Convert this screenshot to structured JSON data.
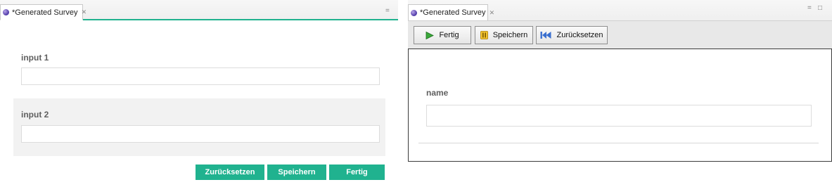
{
  "left_editor": {
    "tab": {
      "title": "*Generated Survey",
      "close_glyph": "✕"
    },
    "minimize_glyph": "=",
    "fields": [
      {
        "label": "input 1",
        "value": ""
      },
      {
        "label": "input 2",
        "value": ""
      }
    ],
    "buttons": {
      "reset": "Zurücksetzen",
      "save": "Speichern",
      "finish": "Fertig"
    },
    "accent_color": "#20b28f"
  },
  "right_editor": {
    "tab": {
      "title": "*Generated Survey",
      "close_glyph": "✕"
    },
    "window_controls": {
      "minimize_glyph": "=",
      "maximize_glyph": "□"
    },
    "toolbar": {
      "finish": {
        "label": "Fertig",
        "icon": "play-icon"
      },
      "save": {
        "label": "Speichern",
        "icon": "pause-icon"
      },
      "reset": {
        "label": "Zurücksetzen",
        "icon": "rewind-icon"
      }
    },
    "fields": [
      {
        "label": "name",
        "value": ""
      }
    ]
  }
}
